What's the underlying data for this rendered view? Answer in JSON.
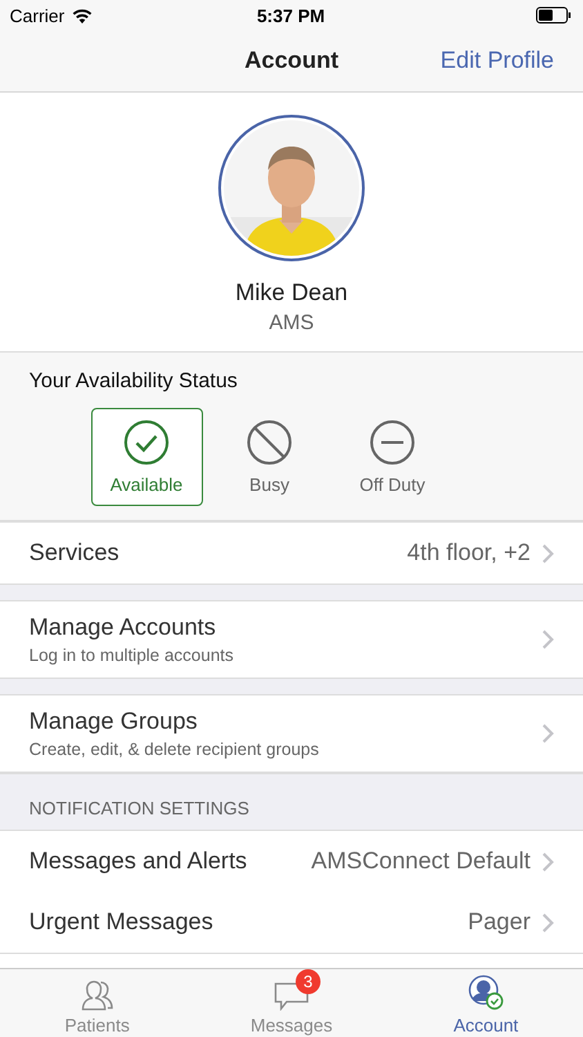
{
  "status_bar": {
    "carrier": "Carrier",
    "time": "5:37 PM"
  },
  "nav": {
    "title": "Account",
    "action": "Edit Profile"
  },
  "profile": {
    "name": "Mike Dean",
    "organization": "AMS"
  },
  "availability": {
    "title": "Your Availability Status",
    "options": [
      {
        "kind": "available",
        "label": "Available",
        "selected": true
      },
      {
        "kind": "busy",
        "label": "Busy",
        "selected": false
      },
      {
        "kind": "off_duty",
        "label": "Off Duty",
        "selected": false
      }
    ]
  },
  "sections": [
    {
      "rows": [
        {
          "title": "Services",
          "value": "4th floor, +2"
        }
      ]
    },
    {
      "rows": [
        {
          "title": "Manage Accounts",
          "subtitle": "Log in to multiple accounts"
        }
      ]
    },
    {
      "rows": [
        {
          "title": "Manage Groups",
          "subtitle": "Create, edit, & delete recipient groups"
        }
      ]
    },
    {
      "header": "NOTIFICATION SETTINGS",
      "rows": [
        {
          "title": "Messages and Alerts",
          "value": "AMSConnect Default"
        },
        {
          "title": "Urgent Messages",
          "value": "Pager"
        }
      ]
    }
  ],
  "tabs": [
    {
      "kind": "patients",
      "label": "Patients",
      "selected": false
    },
    {
      "kind": "messages",
      "label": "Messages",
      "badge": "3",
      "selected": false
    },
    {
      "kind": "account",
      "label": "Account",
      "selected": true
    }
  ]
}
